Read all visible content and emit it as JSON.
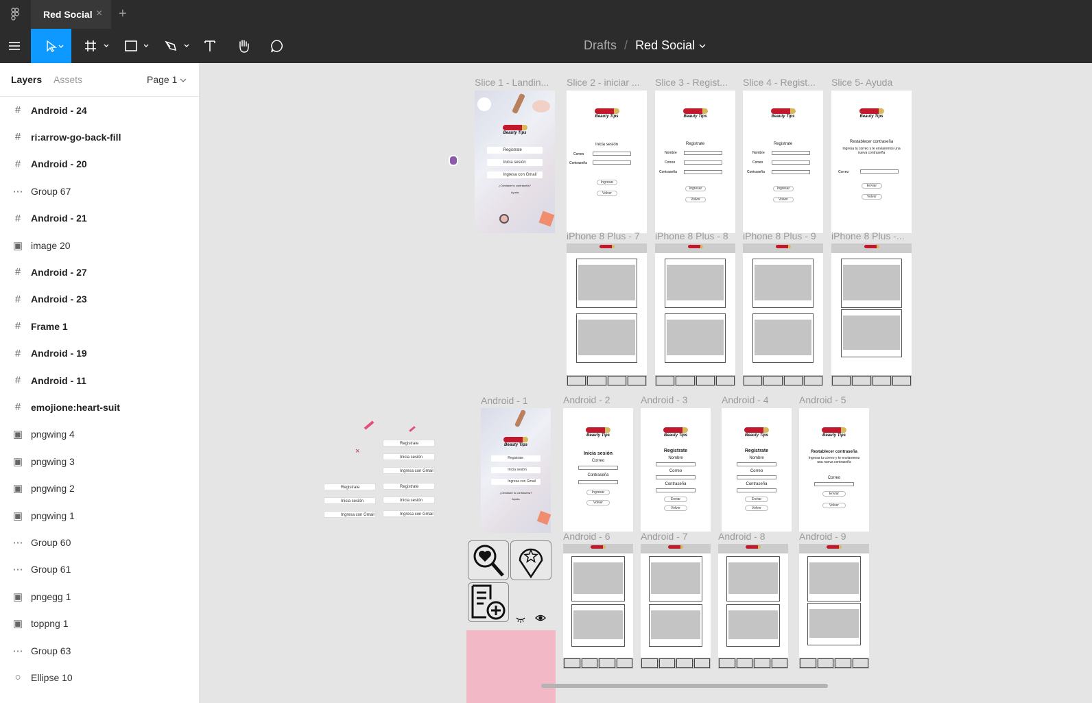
{
  "app": {
    "tab_title": "Red Social",
    "tab_close": "×",
    "new_tab": "+"
  },
  "toolbar": {
    "breadcrumb_parent": "Drafts",
    "breadcrumb_sep": "/",
    "file_name": "Red Social"
  },
  "sidebar": {
    "tab_layers": "Layers",
    "tab_assets": "Assets",
    "page_select": "Page 1",
    "layers": [
      {
        "type": "frame",
        "name": "Android - 24"
      },
      {
        "type": "frame",
        "name": "ri:arrow-go-back-fill"
      },
      {
        "type": "frame",
        "name": "Android - 20"
      },
      {
        "type": "group",
        "name": "Group 67"
      },
      {
        "type": "frame",
        "name": "Android - 21"
      },
      {
        "type": "image",
        "name": "image 20"
      },
      {
        "type": "frame",
        "name": "Android - 27"
      },
      {
        "type": "frame",
        "name": "Android - 23"
      },
      {
        "type": "frame",
        "name": "Frame 1"
      },
      {
        "type": "frame",
        "name": "Android - 19"
      },
      {
        "type": "frame",
        "name": "Android - 11"
      },
      {
        "type": "frame",
        "name": "emojione:heart-suit"
      },
      {
        "type": "image",
        "name": "pngwing 4"
      },
      {
        "type": "image",
        "name": "pngwing 3"
      },
      {
        "type": "image",
        "name": "pngwing 2"
      },
      {
        "type": "image",
        "name": "pngwing 1"
      },
      {
        "type": "group",
        "name": "Group 60"
      },
      {
        "type": "group",
        "name": "Group 61"
      },
      {
        "type": "image",
        "name": "pngegg 1"
      },
      {
        "type": "image",
        "name": "toppng 1"
      },
      {
        "type": "group",
        "name": "Group 63"
      },
      {
        "type": "ellipse",
        "name": "Ellipse 10"
      }
    ]
  },
  "canvas": {
    "top_row_labels": [
      "Slice 1 - Landin...",
      "Slice 2 - iniciar ...",
      "Slice 3 - Regist...",
      "Slice 4 - Regist...",
      "Slice 5- Ayuda"
    ],
    "iphone_labels": [
      "iPhone 8 Plus - 7",
      "iPhone 8 Plus - 8",
      "iPhone 8 Plus - 9",
      "iPhone 8 Plus -..."
    ],
    "android_labels": [
      "Android - 1",
      "Android - 2",
      "Android - 3",
      "Android - 4",
      "Android - 5"
    ],
    "android_feed_labels": [
      "Android - 6",
      "Android - 7",
      "Android - 8",
      "Android - 9"
    ],
    "logo_text": "Beauty Tips",
    "btn_registrate": "Registrate",
    "btn_inicia": "Inicia sesión",
    "btn_gmail": "Ingresa con Gmail",
    "forgot": "¿Olvidaste tu contraseña?",
    "ayuda": "Ayuda",
    "lbl_inicia": "Inicia sesión",
    "lbl_registrate": "Registrate",
    "lbl_restablecer": "Restablecer contraseña",
    "restablecer_info": "Ingresa tu correo y te enviaremos una nueva contraseña",
    "f_correo": "Correo",
    "f_nombre": "Nombre",
    "f_contrasena": "Contraseña",
    "b_ingresar": "Ingresar",
    "b_volver": "Volver",
    "b_enviar": "Enviar"
  },
  "colors": {
    "dark_ui": "#2c2c2c",
    "accent": "#0d99ff",
    "canvas_bg": "#e5e5e5",
    "pink_block": "#f2b8c6"
  }
}
